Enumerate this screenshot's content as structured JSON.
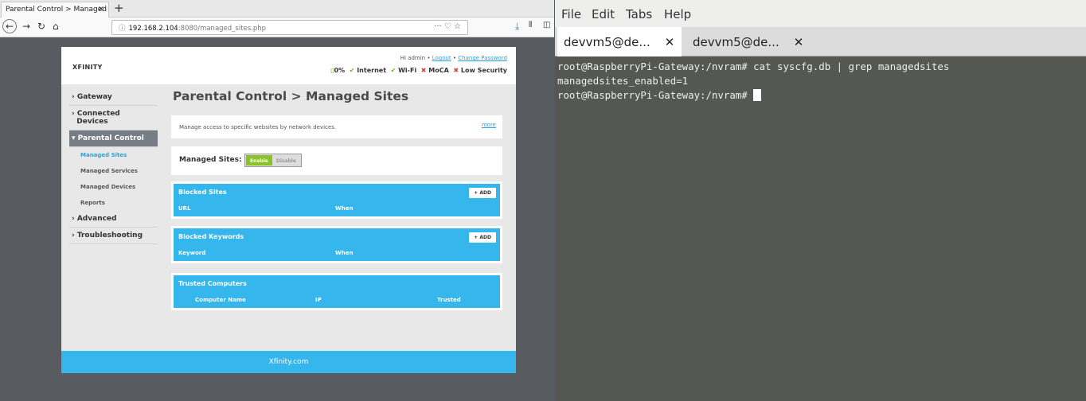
{
  "browser": {
    "tab_title": "Parental Control > Managed",
    "tab_close": "×",
    "new_tab": "+",
    "url_host": "192.168.2.104",
    "url_rest": ":8080/managed_sites.php",
    "url_actions": "··· ♡ ☆"
  },
  "site": {
    "logo": "XFINITY",
    "greeting": "Hi admin",
    "logout": "Logout",
    "change_password": "Change Password",
    "status": {
      "battery": "0%",
      "internet": "Internet",
      "wifi": "Wi-Fi",
      "moca": "MoCA",
      "security": "Low Security"
    },
    "sidebar": {
      "gateway": "Gateway",
      "connected_devices_1": "Connected",
      "connected_devices_2": "Devices",
      "parental_control": "Parental Control",
      "managed_sites": "Managed Sites",
      "managed_services": "Managed Services",
      "managed_devices": "Managed Devices",
      "reports": "Reports",
      "advanced": "Advanced",
      "troubleshooting": "Troubleshooting"
    },
    "page_title": "Parental Control > Managed Sites",
    "description": "Manage access to specific websites by network devices.",
    "more": "more",
    "managed_sites_label": "Managed Sites:",
    "enable": "Enable",
    "disable": "Disable",
    "blocked_sites": {
      "title": "Blocked Sites",
      "add": "+ ADD",
      "col1": "URL",
      "col2": "When"
    },
    "blocked_keywords": {
      "title": "Blocked Keywords",
      "add": "+ ADD",
      "col1": "Keyword",
      "col2": "When"
    },
    "trusted": {
      "title": "Trusted Computers",
      "col1": "Computer Name",
      "col2": "IP",
      "col3": "Trusted"
    },
    "footer": "Xfinity.com"
  },
  "terminal": {
    "menus": [
      "File",
      "Edit",
      "Tabs",
      "Help"
    ],
    "tabs": [
      {
        "label": "devvm5@de...",
        "close": "✕"
      },
      {
        "label": "devvm5@de...",
        "close": "✕"
      }
    ],
    "lines": [
      "root@RaspberryPi-Gateway:/nvram# cat syscfg.db | grep managedsites",
      "managedsites_enabled=1",
      "root@RaspberryPi-Gateway:/nvram# "
    ]
  }
}
